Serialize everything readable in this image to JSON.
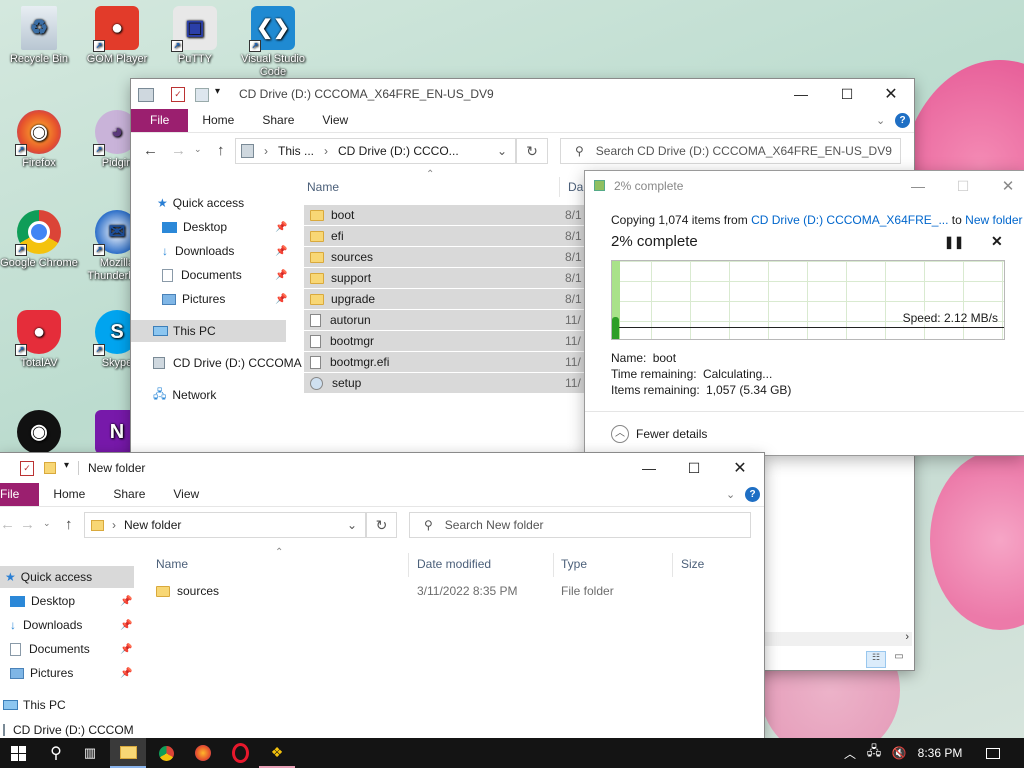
{
  "desktop_icons": [
    {
      "label": "Recycle Bin",
      "icon": "recycle-bin-icon"
    },
    {
      "label": "GOM Player",
      "icon": "gom-player-icon"
    },
    {
      "label": "PuTTY",
      "icon": "putty-icon"
    },
    {
      "label": "Visual Studio Code",
      "icon": "vscode-icon"
    },
    {
      "label": "Firefox",
      "icon": "firefox-icon"
    },
    {
      "label": "Pidgin",
      "icon": "pidgin-icon"
    },
    {
      "label": "Google Chrome",
      "icon": "chrome-icon"
    },
    {
      "label": "Mozilla Thunderbird",
      "icon": "thunderbird-icon"
    },
    {
      "label": "TotalAV",
      "icon": "totalav-icon"
    },
    {
      "label": "Skype",
      "icon": "skype-icon"
    },
    {
      "label": "",
      "icon": "penguin-app-icon"
    },
    {
      "label": "",
      "icon": "onenote-icon"
    }
  ],
  "cd_window": {
    "title": "CD Drive (D:) CCCOMA_X64FRE_EN-US_DV9",
    "tabs": [
      "File",
      "Home",
      "Share",
      "View"
    ],
    "address": {
      "part1": "This ...",
      "part2": "CD Drive (D:) CCCO..."
    },
    "search_placeholder": "Search CD Drive (D:) CCCOMA_X64FRE_EN-US_DV9",
    "nav": {
      "quick_access": "Quick access",
      "desktop": "Desktop",
      "downloads": "Downloads",
      "documents": "Documents",
      "pictures": "Pictures",
      "this_pc": "This PC",
      "cd_drive": "CD Drive (D:) CCCOMA",
      "network": "Network"
    },
    "columns": {
      "name": "Name",
      "date": "Da"
    },
    "files": [
      {
        "name": "boot",
        "date": "8/1",
        "kind": "folder"
      },
      {
        "name": "efi",
        "date": "8/1",
        "kind": "folder"
      },
      {
        "name": "sources",
        "date": "8/1",
        "kind": "folder"
      },
      {
        "name": "support",
        "date": "8/1",
        "kind": "folder"
      },
      {
        "name": "upgrade",
        "date": "8/1",
        "kind": "folder"
      },
      {
        "name": "autorun",
        "date": "11/",
        "kind": "file"
      },
      {
        "name": "bootmgr",
        "date": "11/",
        "kind": "file"
      },
      {
        "name": "bootmgr.efi",
        "date": "11/",
        "kind": "file"
      },
      {
        "name": "setup",
        "date": "11/",
        "kind": "setup"
      }
    ]
  },
  "copy_dialog": {
    "title": "2% complete",
    "copying_prefix": "Copying 1,074 items from",
    "source_link": "CD Drive (D:) CCCOMA_X64FRE_...",
    "to_word": "to",
    "dest_link": "New folder",
    "percent_label": "2% complete",
    "progress": 0.02,
    "speed": "Speed: 2.12 MB/s",
    "name_label": "Name:",
    "name_value": "boot",
    "time_label": "Time remaining:",
    "time_value": "Calculating...",
    "items_label": "Items remaining:",
    "items_value": "1,057 (5.34 GB)",
    "fewer_details": "Fewer details"
  },
  "nf_window": {
    "title": "New folder",
    "tabs": [
      "File",
      "Home",
      "Share",
      "View"
    ],
    "address": "New folder",
    "search_placeholder": "Search New folder",
    "nav": {
      "quick_access": "Quick access",
      "desktop": "Desktop",
      "downloads": "Downloads",
      "documents": "Documents",
      "pictures": "Pictures",
      "this_pc": "This PC",
      "cd_drive": "CD Drive (D:) CCCOM"
    },
    "columns": {
      "name": "Name",
      "date": "Date modified",
      "type": "Type",
      "size": "Size"
    },
    "files": [
      {
        "name": "sources",
        "date": "3/11/2022 8:35 PM",
        "type": "File folder",
        "size": ""
      }
    ]
  },
  "taskbar": {
    "time": "8:36 PM",
    "apps": [
      "windows-start-icon",
      "search-icon",
      "task-view-icon",
      "file-explorer-icon",
      "chrome-icon",
      "firefox-icon",
      "opera-icon",
      "paint-icon"
    ]
  },
  "colors": {
    "file_tab": "#9b1f6f",
    "progress_green": "#7bd05a",
    "link_blue": "#0066cc",
    "selection": "#d9d9d9"
  }
}
